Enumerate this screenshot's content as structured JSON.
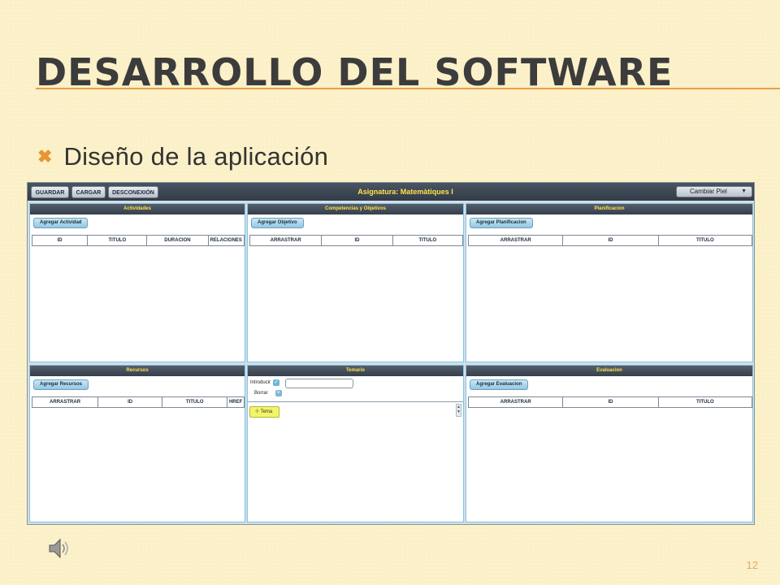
{
  "slide": {
    "title": "Desarrollo del software",
    "bullet": "Diseño de la aplicación",
    "page_number": "12"
  },
  "app": {
    "toolbar": {
      "buttons": [
        "GUARDAR",
        "CARGAR",
        "DESCONEXIÓN"
      ],
      "title": "Asignatura: Matemàtiques I",
      "skin_select_value": "Cambiar Piel"
    },
    "panels": {
      "actividades": {
        "title": "Actividades",
        "button": "Agregar Actividad",
        "columns": [
          "ID",
          "TITULO",
          "DURACION",
          "RELACIONES"
        ]
      },
      "competencias": {
        "title": "Competencias y Objetivos",
        "button": "Agregar Objetivo",
        "columns": [
          "ARRASTRAR",
          "ID",
          "TITULO"
        ]
      },
      "planificacion": {
        "title": "Planificacion",
        "button": "Agregar Planificacion",
        "columns": [
          "ARRASTRAR",
          "ID",
          "TITULO"
        ]
      },
      "recursos": {
        "title": "Recursos",
        "button": "Agregar Recursos",
        "columns": [
          "ARRASTRAR",
          "ID",
          "TITULO",
          "HREF"
        ]
      },
      "temario": {
        "title": "Temario",
        "introducir_label": "Introducir",
        "borrar_label": "Borrar",
        "node_label": "Tema",
        "node_icon": "plus-icon"
      },
      "evaluacion": {
        "title": "Evaluacion",
        "button": "Agregar Evaluacion",
        "columns": [
          "ARRASTRAR",
          "ID",
          "TITULO"
        ]
      }
    }
  },
  "colors": {
    "background": "#fbefc4",
    "title_rule": "#e5a048",
    "bullet_accent": "#e69533",
    "panel_header_text": "#ffe14d",
    "panel_border": "#7cc6ea"
  }
}
